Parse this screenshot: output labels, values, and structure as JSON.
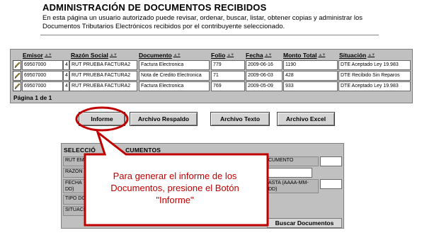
{
  "page": {
    "title": "ADMINISTRACIÓN DE DOCUMENTOS RECIBIDOS",
    "description": "En esta página un usuario autorizado puede revisar, ordenar, buscar, listar, obtener copias y administrar los Documentos Tributarios Electrónicos recibidos por el contribuyente seleccionado."
  },
  "grid": {
    "columns": [
      "Emisor",
      "Razón Social",
      "Documento",
      "Folio",
      "Fecha",
      "Monto Total",
      "Situación"
    ],
    "sort_glyph": "▲▼",
    "rows": [
      {
        "emisor": "69507000",
        "dv": "4",
        "razon": "RUT PRUEBA FACTURA2",
        "documento": "Factura Electronica",
        "folio": "779",
        "fecha": "2009-06-16",
        "monto": "1190",
        "situacion": "DTE Aceptado Ley 19.983"
      },
      {
        "emisor": "69507000",
        "dv": "4",
        "razon": "RUT PRUEBA FACTURA2",
        "documento": "Nota de Credito Electronica",
        "folio": "71",
        "fecha": "2009-06-03",
        "monto": "428",
        "situacion": "DTE Recibido Sin Reparos"
      },
      {
        "emisor": "69507000",
        "dv": "4",
        "razon": "RUT PRUEBA FACTURA2",
        "documento": "Factura Electronica",
        "folio": "769",
        "fecha": "2009-05-09",
        "monto": "933",
        "situacion": "DTE Aceptado Ley 19.983"
      }
    ],
    "pager": "Página 1 de 1"
  },
  "actions": {
    "informe": "Informe",
    "respaldo": "Archivo Respaldo",
    "texto": "Archivo Texto",
    "excel": "Archivo Excel"
  },
  "search": {
    "title_left": "SELECCIÓ",
    "title_right": "CUMENTOS",
    "labels": {
      "rut": "RUT EM",
      "razon": "RAZÓN",
      "fecha": "FECHA\nDD)",
      "tipo": "TIPO DO",
      "situacion": "SITUACI",
      "hasta_doc": "CUMENTO",
      "hasta_fecha": "ASTA (AAAA-MM-\nDD)"
    },
    "button": "Buscar Documentos"
  },
  "callout": {
    "text": "Para generar el informe de los Documentos, presione el Botón \"Informe\"",
    "color": "#c00000"
  },
  "icons": {
    "edit": "edit-pencil-icon"
  }
}
